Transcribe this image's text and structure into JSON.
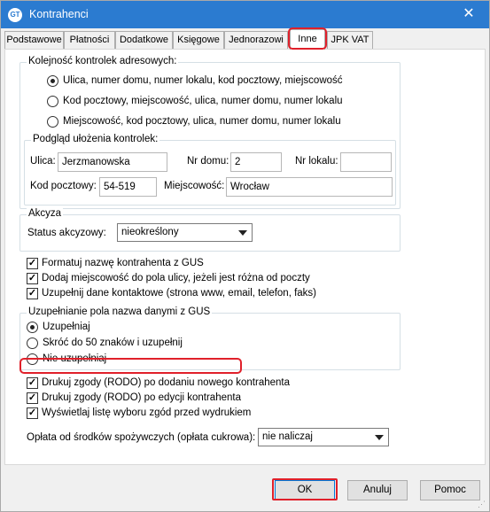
{
  "window": {
    "title": "Kontrahenci",
    "icon": "app-logo-icon",
    "close_symbol": "✕"
  },
  "tabs": [
    "Podstawowe",
    "Płatności",
    "Dodatkowe",
    "Księgowe",
    "Jednorazowi",
    "Inne",
    "JPK VAT"
  ],
  "active_tab": "Inne",
  "order_group": {
    "legend": "Kolejność kontrolek adresowych:",
    "options": [
      "Ulica, numer domu, numer lokalu, kod pocztowy, miejscowość",
      "Kod pocztowy, miejscowość, ulica, numer domu, numer lokalu",
      "Miejscowość, kod pocztowy, ulica, numer domu, numer lokalu"
    ],
    "selected_index": 0
  },
  "preview_group": {
    "legend": "Podgląd ułożenia kontrolek:",
    "street_label": "Ulica:",
    "street_value": "Jerzmanowska",
    "house_label": "Nr domu:",
    "house_value": "2",
    "flat_label": "Nr lokalu:",
    "flat_value": "",
    "postal_label": "Kod pocztowy:",
    "postal_value": "54-519",
    "city_label": "Miejscowość:",
    "city_value": "Wrocław"
  },
  "excise_group": {
    "legend": "Akcyza",
    "status_label": "Status akcyzowy:",
    "status_value": "nieokreślony"
  },
  "checkboxes_top": [
    {
      "label": "Formatuj nazwę kontrahenta z GUS",
      "checked": true
    },
    {
      "label": "Dodaj miejscowość do pola ulicy, jeżeli jest różna od poczty",
      "checked": true
    },
    {
      "label": "Uzupełnij dane kontaktowe (strona www, email, telefon, faks)",
      "checked": true
    }
  ],
  "gus_group": {
    "legend": "Uzupełnianie pola nazwa danymi z GUS",
    "options": [
      "Uzupełniaj",
      "Skróć do 50 znaków i uzupełnij",
      "Nie uzupełniaj"
    ],
    "selected_index": 0
  },
  "checkboxes_rodo": [
    {
      "label": "Drukuj zgody (RODO) po dodaniu nowego kontrahenta",
      "checked": true
    },
    {
      "label": "Drukuj zgody (RODO) po edycji kontrahenta",
      "checked": true
    },
    {
      "label": "Wyświetlaj listę wyboru zgód przed wydrukiem",
      "checked": true
    }
  ],
  "sugar_fee": {
    "label": "Opłata od środków spożywczych (opłata cukrowa):",
    "value": "nie naliczaj"
  },
  "buttons": {
    "ok": "OK",
    "cancel": "Anuluj",
    "help": "Pomoc"
  },
  "check_mark": "✓",
  "highlight_color": "#e0202a"
}
